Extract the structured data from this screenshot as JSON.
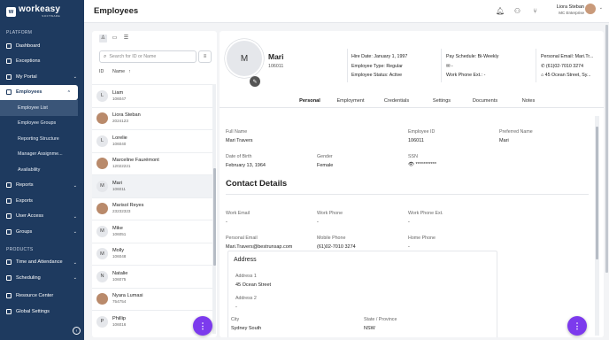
{
  "app": {
    "logo_text": "workeasy",
    "logo_sub": "SOFTWARE"
  },
  "sidebar": {
    "section_platform": "PLATFORM",
    "section_products": "PRODUCTS",
    "items": {
      "dashboard": "Dashboard",
      "exceptions": "Exceptions",
      "my_portal": "My Portal",
      "employees": "Employees",
      "reports": "Reports",
      "exports": "Exports",
      "user_access": "User Access",
      "groups": "Groups",
      "time_attendance": "Time and Attendance",
      "scheduling": "Scheduling",
      "resource_center": "Resource Center",
      "global_settings": "Global Settings"
    },
    "employees_sub": {
      "employee_list": "Employee List",
      "employee_groups": "Employee Groups",
      "reporting_structure": "Reporting Structure",
      "manager_assignment": "Manager Assignme...",
      "availability": "Availability"
    }
  },
  "header": {
    "title": "Employees",
    "user_name": "Liora Steban",
    "user_org": "MC Enterprise"
  },
  "list": {
    "search_placeholder": "Search for ID or Name",
    "col_id": "ID",
    "col_name": "Name",
    "sort_arrow": "↑",
    "rows": [
      {
        "initial": "L",
        "name": "Liam",
        "id": "106047",
        "photo": false,
        "selected": false
      },
      {
        "initial": "L",
        "name": "Liora Steban",
        "id": "2024123",
        "photo": true,
        "selected": false
      },
      {
        "initial": "L",
        "name": "Lorelie",
        "id": "106040",
        "photo": false,
        "selected": false
      },
      {
        "initial": "M",
        "name": "Marceline Faurémont",
        "id": "12022221",
        "photo": true,
        "selected": false
      },
      {
        "initial": "M",
        "name": "Mari",
        "id": "106011",
        "photo": false,
        "selected": true
      },
      {
        "initial": "M",
        "name": "Marisol Reyes",
        "id": "23232323",
        "photo": true,
        "selected": false
      },
      {
        "initial": "M",
        "name": "Mike",
        "id": "106051",
        "photo": false,
        "selected": false
      },
      {
        "initial": "M",
        "name": "Molly",
        "id": "106048",
        "photo": false,
        "selected": false
      },
      {
        "initial": "N",
        "name": "Natalie",
        "id": "106075",
        "photo": false,
        "selected": false
      },
      {
        "initial": "N",
        "name": "Nyara Lumasi",
        "id": "754754",
        "photo": true,
        "selected": false
      },
      {
        "initial": "P",
        "name": "Phillip",
        "id": "106016",
        "photo": false,
        "selected": false
      }
    ]
  },
  "profile": {
    "avatar_initial": "M",
    "name": "Mari",
    "id": "106011",
    "hire_date": "Hire Date: January 1, 1997",
    "employee_type": "Employee Type: Regular",
    "employee_status": "Employee Status: Active",
    "pay_schedule": "Pay Schedule: Bi-Weekly",
    "pay_email": "-",
    "work_phone_ext": "Work Phone Ext.: -",
    "personal_email": "Personal Email: Mari.Tr...",
    "personal_phone": "(61)02-7010 3274",
    "personal_address": "45 Ocean Street, Sy..."
  },
  "tabs": [
    "Personal",
    "Employment",
    "Credentials",
    "Settings",
    "Documents",
    "Notes"
  ],
  "personal": {
    "full_name_label": "Full Name",
    "full_name": "Mari Travers",
    "employee_id_label": "Employee ID",
    "employee_id": "106011",
    "preferred_name_label": "Preferred Name",
    "preferred_name": "Mari",
    "dob_label": "Date of Birth",
    "dob": "February 13, 1964",
    "gender_label": "Gender",
    "gender": "Female",
    "ssn_label": "SSN",
    "ssn": "***********"
  },
  "contact": {
    "title": "Contact Details",
    "work_email_label": "Work Email",
    "work_email": "-",
    "work_phone_label": "Work Phone",
    "work_phone": "-",
    "work_phone_ext_label": "Work Phone Ext.",
    "work_phone_ext": "-",
    "personal_email_label": "Personal Email",
    "personal_email": "Mari.Travers@bestrunsap.com",
    "mobile_phone_label": "Mobile Phone",
    "mobile_phone": "(61)02-7010 3274",
    "home_phone_label": "Home Phone",
    "home_phone": "-"
  },
  "address": {
    "title": "Address",
    "address1_label": "Address 1",
    "address1": "45 Ocean Street",
    "address2_label": "Address 2",
    "address2": "-",
    "city_label": "City",
    "city": "Sydney South",
    "state_label": "State / Province",
    "state": "NSW"
  },
  "fab_label": "⋮",
  "colors": {
    "sidebar": "#1e3a5f",
    "fab": "#7c3aed"
  }
}
